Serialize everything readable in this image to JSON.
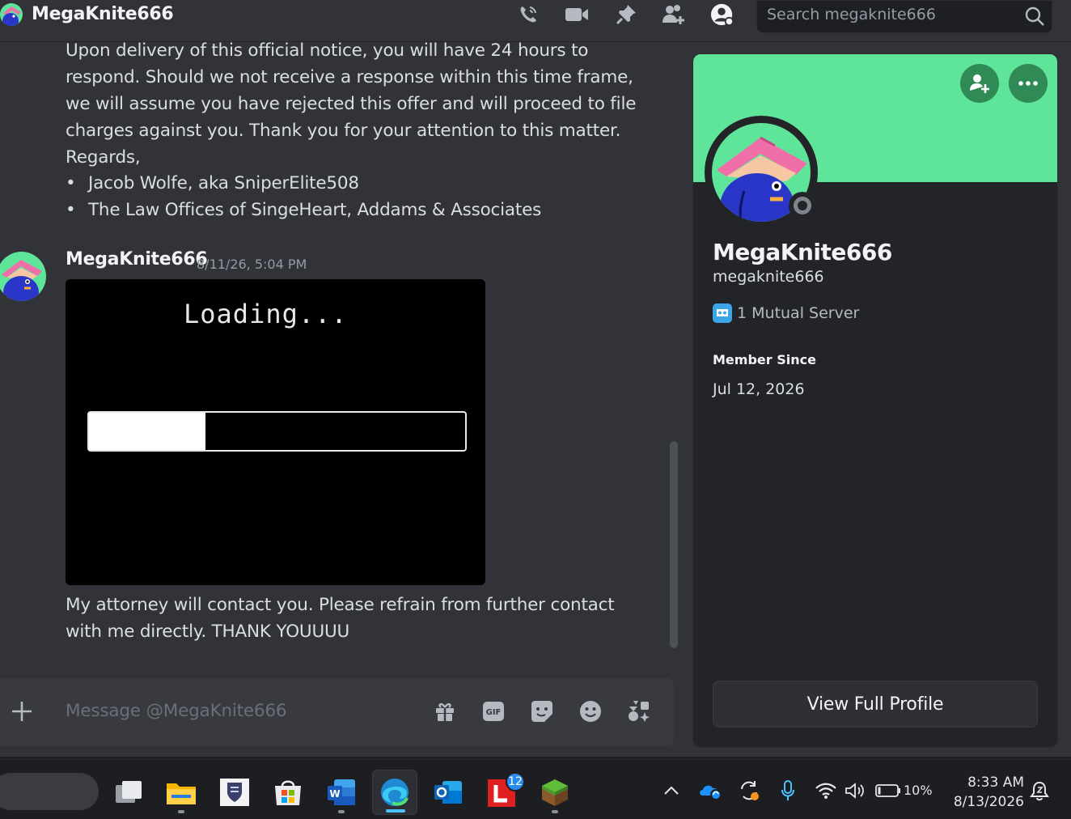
{
  "header": {
    "title": "MegaKnite666",
    "icons": [
      "voice-call-icon",
      "video-call-icon",
      "pin-icon",
      "add-friends-icon",
      "user-profile-icon"
    ],
    "search_placeholder": "Search megaknite666"
  },
  "chat": {
    "previous_message_lines": [
      "Upon delivery of this official notice, you will have 24 hours to",
      "respond. Should we not receive a response within this time frame,",
      "we will assume you have rejected this offer and will proceed to file",
      "charges against you. Thank you for your attention to this matter.",
      "Regards,"
    ],
    "bullets": [
      "Jacob Wolfe, aka SniperElite508",
      "The Law Offices of SingeHeart, Addams & Associates"
    ],
    "message": {
      "author": "MegaKnite666",
      "timestamp": "8/11/26, 5:04 PM",
      "gif_text": "Loading...",
      "gif_progress_percent": 31,
      "body_lines": [
        "My attorney will contact you. Please refrain from further contact",
        "with me directly. THANK YOUUUU"
      ]
    }
  },
  "composer": {
    "placeholder": "Message @MegaKnite666",
    "buttons": [
      "gift-icon",
      "gif-icon",
      "sticker-icon",
      "emoji-icon",
      "apps-icon"
    ],
    "gif_label": "GIF"
  },
  "profile": {
    "display_name": "MegaKnite666",
    "username": "megaknite666",
    "mutual_servers": "1 Mutual Server",
    "member_since_label": "Member Since",
    "member_since_value": "Jul 12, 2026",
    "view_full_profile": "View Full Profile",
    "banner_color": "#5fe59a",
    "status": "offline"
  },
  "taskbar": {
    "apps": [
      "task-view",
      "file-explorer",
      "shield-app",
      "microsoft-store",
      "word",
      "edge",
      "outlook",
      "l-app",
      "minecraft"
    ],
    "notification_badge": "12",
    "battery": "10%",
    "time": "8:33 AM",
    "date": "8/13/2026"
  }
}
